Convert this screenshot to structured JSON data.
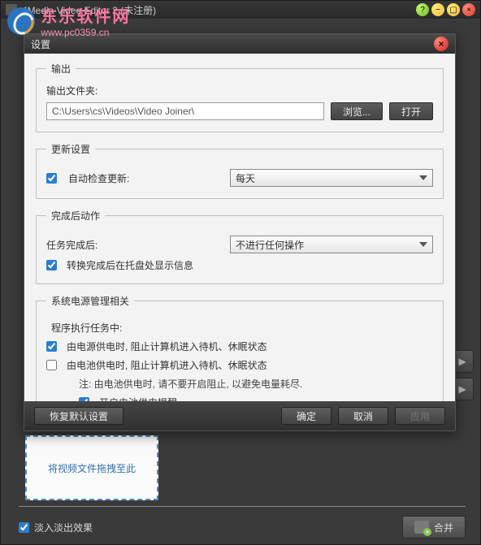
{
  "app": {
    "title": "4Media Video Editor 2 (未注册)"
  },
  "watermark": {
    "text": "东乐软件网",
    "url": "www.pc0359.cn"
  },
  "main": {
    "dropzone": "将视频文件拖拽至此",
    "fade_label": "淡入淡出效果",
    "merge_label": "合并"
  },
  "dialog": {
    "title": "设置",
    "sections": {
      "output": {
        "legend": "输出",
        "folder_label": "输出文件夹:",
        "folder_value": "C:\\Users\\cs\\Videos\\Video Joiner\\",
        "browse": "浏览...",
        "open": "打开"
      },
      "update": {
        "legend": "更新设置",
        "auto_check": "自动检查更新:",
        "interval": "每天"
      },
      "after": {
        "legend": "完成后动作",
        "label": "任务完成后:",
        "value": "不进行任何操作",
        "tray": "转换完成后在托盘处显示信息"
      },
      "power": {
        "legend": "系统电源管理相关",
        "running_label": "程序执行任务中:",
        "ac": "由电源供电时, 阻止计算机进入待机、休眠状态",
        "battery": "由电池供电时, 阻止计算机进入待机、休眠状态",
        "note": "注: 由电池供电时, 请不要开启阻止, 以避免电量耗尽.",
        "reminder": "开启电池供电提醒"
      }
    },
    "footer": {
      "restore": "恢复默认设置",
      "ok": "确定",
      "cancel": "取消",
      "apply": "应用"
    }
  }
}
